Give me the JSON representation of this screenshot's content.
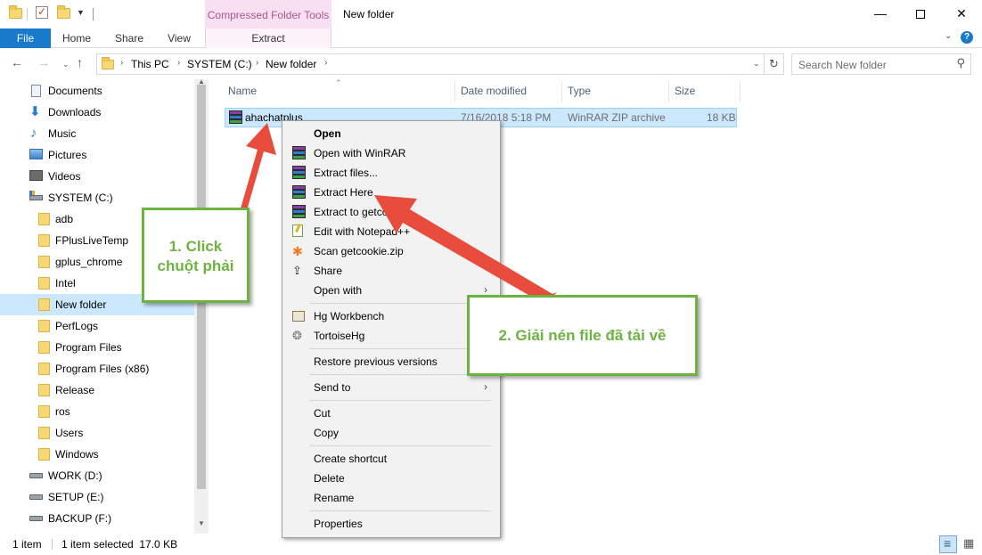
{
  "window": {
    "title": "New folder",
    "context_tab_group": "Compressed Folder Tools",
    "minimize": "—",
    "close": "✕"
  },
  "ribbon": {
    "tabs": [
      "File",
      "Home",
      "Share",
      "View",
      "Extract"
    ],
    "collapse_glyph": "⌄",
    "help_glyph": "?"
  },
  "address": {
    "crumbs": [
      "This PC",
      "SYSTEM (C:)",
      "New folder"
    ],
    "search_placeholder": "Search New folder"
  },
  "nav_pane": {
    "items": [
      {
        "label": "Documents",
        "icon": "documents-icon"
      },
      {
        "label": "Downloads",
        "icon": "downloads-icon"
      },
      {
        "label": "Music",
        "icon": "music-icon"
      },
      {
        "label": "Pictures",
        "icon": "pictures-icon"
      },
      {
        "label": "Videos",
        "icon": "videos-icon"
      },
      {
        "label": "SYSTEM (C:)",
        "icon": "system-drive-icon"
      },
      {
        "label": "adb",
        "icon": "folder-icon"
      },
      {
        "label": "FPlusLiveTemp",
        "icon": "folder-icon"
      },
      {
        "label": "gplus_chrome",
        "icon": "folder-icon"
      },
      {
        "label": "Intel",
        "icon": "folder-icon"
      },
      {
        "label": "New folder",
        "icon": "folder-icon",
        "selected": true
      },
      {
        "label": "PerfLogs",
        "icon": "folder-icon"
      },
      {
        "label": "Program Files",
        "icon": "folder-icon"
      },
      {
        "label": "Program Files (x86)",
        "icon": "folder-icon"
      },
      {
        "label": "Release",
        "icon": "folder-icon"
      },
      {
        "label": "ros",
        "icon": "folder-icon"
      },
      {
        "label": "Users",
        "icon": "folder-icon"
      },
      {
        "label": "Windows",
        "icon": "folder-icon"
      },
      {
        "label": "WORK (D:)",
        "icon": "drive-icon"
      },
      {
        "label": "SETUP (E:)",
        "icon": "drive-icon"
      },
      {
        "label": "BACKUP (F:)",
        "icon": "drive-icon"
      }
    ]
  },
  "file_list": {
    "columns": [
      "Name",
      "Date modified",
      "Type",
      "Size"
    ],
    "rows": [
      {
        "name": "ahachatplus",
        "date": "7/16/2018 5:18 PM",
        "type": "WinRAR ZIP archive",
        "size": "18 KB"
      }
    ]
  },
  "context_menu": {
    "open": "Open",
    "open_with_winrar": "Open with WinRAR",
    "extract_files": "Extract files...",
    "extract_here": "Extract Here",
    "extract_to": "Extract to getcookie\\",
    "edit_notepad": "Edit with Notepad++",
    "scan": "Scan getcookie.zip",
    "share": "Share",
    "open_with": "Open with",
    "hg_workbench": "Hg Workbench",
    "tortoisehg": "TortoiseHg",
    "restore": "Restore previous versions",
    "send_to": "Send to",
    "cut": "Cut",
    "copy": "Copy",
    "create_shortcut": "Create shortcut",
    "delete": "Delete",
    "rename": "Rename",
    "properties": "Properties"
  },
  "status": {
    "item_count": "1 item",
    "selection": "1 item selected  17.0 KB"
  },
  "callouts": {
    "step1_line1": "1. Click",
    "step1_line2": "chuột phải",
    "step2": "2. Giải nén file đã tải về"
  },
  "colors": {
    "file_tab": "#1979ca",
    "selection": "#cce8ff",
    "callout_green": "#6db33f",
    "arrow_red": "#e74c3c",
    "context_tab_bg": "#f9dff2"
  }
}
